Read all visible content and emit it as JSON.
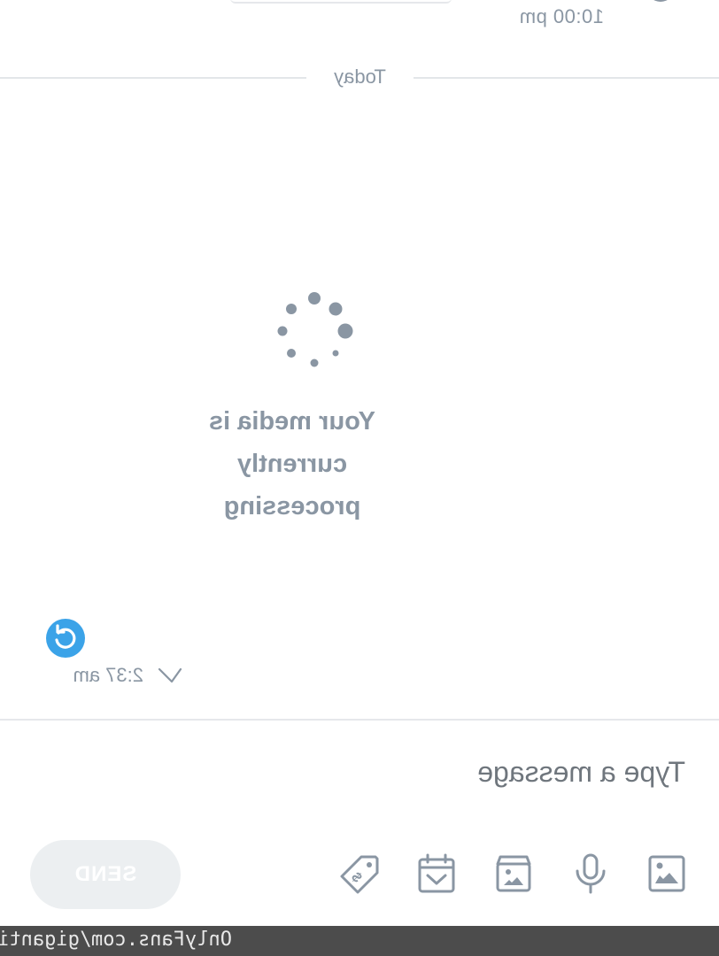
{
  "chat": {
    "previous_message_time": "10:00 pm",
    "day_divider": "Today",
    "media_status": "Your media is currently processing",
    "message_time": "2:37 am",
    "resend_icon": "refresh-icon",
    "delivered_icon": "check-icon"
  },
  "composer": {
    "placeholder": "Type a message",
    "send_label": "SEND",
    "tools": [
      {
        "name": "image-icon"
      },
      {
        "name": "microphone-icon"
      },
      {
        "name": "vault-icon"
      },
      {
        "name": "schedule-icon"
      },
      {
        "name": "price-tag-icon"
      }
    ]
  },
  "watermark": "OnlyFans.com/gigantits",
  "colors": {
    "muted_text": "#8a96a3",
    "accent": "#3ba3e8",
    "divider": "#e6e8eb",
    "send_disabled_bg": "#eceff1",
    "footer_bg": "#4c4c4c"
  }
}
